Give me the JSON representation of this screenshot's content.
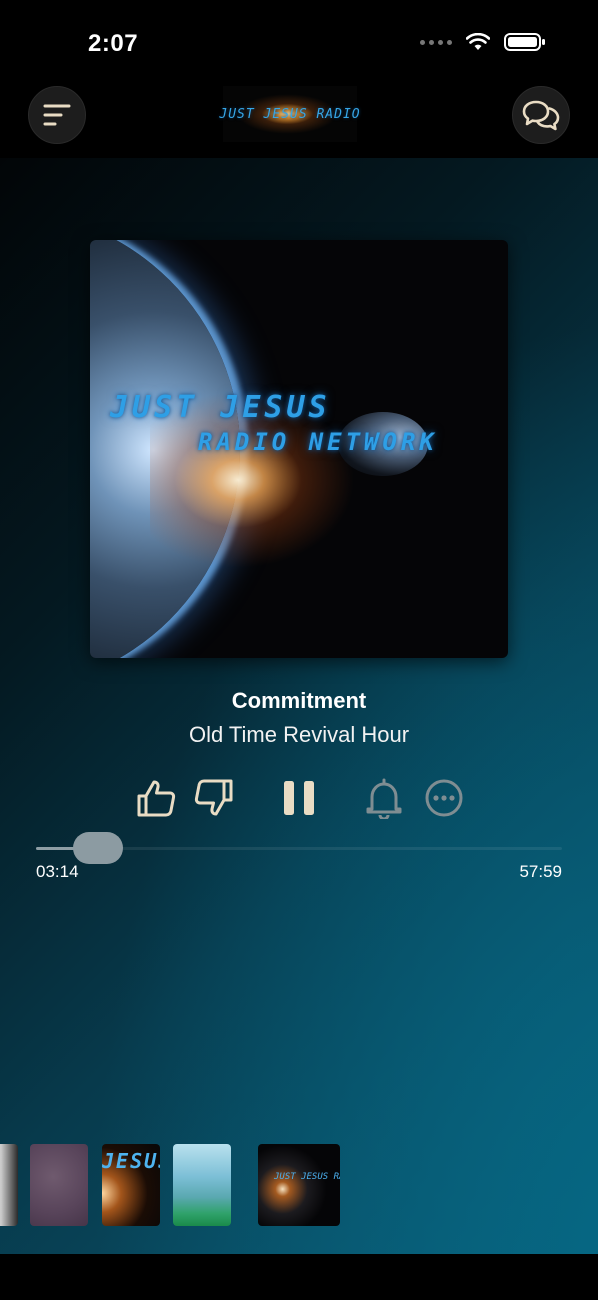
{
  "status_bar": {
    "time": "2:07"
  },
  "header": {
    "logo_text": "JUST JESUS RADIO",
    "menu_icon": "menu-lines-icon",
    "chat_icon": "chat-bubbles-icon"
  },
  "album": {
    "art_text_line1": "JUST JESUS",
    "art_text_line2": "RADIO NETWORK"
  },
  "track": {
    "title": "Commitment",
    "show": "Old Time Revival Hour"
  },
  "controls": {
    "like_icon": "thumbs-up-icon",
    "dislike_icon": "thumbs-down-icon",
    "pause_icon": "pause-icon",
    "alert_icon": "bell-icon",
    "more_icon": "more-options-icon"
  },
  "progress": {
    "elapsed": "03:14",
    "total": "57:59",
    "fraction": 0.056
  },
  "recent": {
    "items": [
      {
        "label": ""
      },
      {
        "label": ""
      },
      {
        "label": "JESUS RADIO"
      },
      {
        "label": ""
      },
      {
        "label": "JUST JESUS RADIO NETWORK"
      }
    ]
  },
  "colors": {
    "icon_beige": "#e9dcc4",
    "icon_gray": "#7f8d92",
    "accent_blue": "#2e9fe6",
    "panel_teal": "#0a5a74"
  }
}
